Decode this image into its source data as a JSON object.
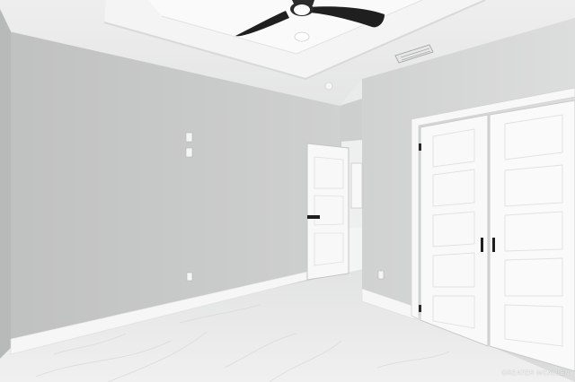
{
  "colors": {
    "wall_left": "#c9caca",
    "wall_back": "#d3d4d4",
    "wall_right": "#d7d8d8",
    "ceiling": "#f1f2f2",
    "tray_ceiling": "#f7f7f7",
    "floor": "#eceded",
    "door_white": "#f7f7f7",
    "baseboard": "#f4f4f4",
    "fan_blade": "#1f1f1f"
  },
  "icons": {
    "ceiling_fan": "ceiling-fan-icon",
    "air_vent": "air-vent-icon",
    "light_switch": "light-switch-icon",
    "outlet": "outlet-icon"
  },
  "watermark": {
    "text": "GREATER MCALLEN"
  }
}
